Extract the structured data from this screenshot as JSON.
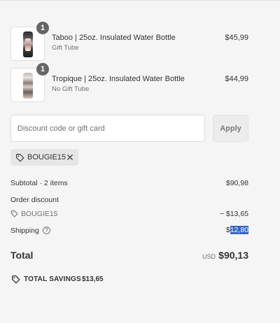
{
  "cart": {
    "items": [
      {
        "name": "Taboo | 25oz. Insulated Water Bottle",
        "variant": "Gift Tube",
        "price": "$45,99",
        "quantity": "1",
        "thumb": "taboo"
      },
      {
        "name": "Tropique | 25oz. Insulated Water Bottle",
        "variant": "No Gift Tube",
        "price": "$44,99",
        "quantity": "1",
        "thumb": "tropique"
      }
    ]
  },
  "discount": {
    "placeholder": "Discount code or gift card",
    "value": "",
    "apply_label": "Apply",
    "applied_code": "BOUGIE15"
  },
  "summary": {
    "subtotal_label": "Subtotal · 2 items",
    "subtotal_value": "$90,98",
    "order_discount_label": "Order discount",
    "code_label": "BOUGIE15",
    "code_value": "− $13,65",
    "shipping_label": "Shipping",
    "shipping_help": "?",
    "shipping_currency_symbol": "$",
    "shipping_value_selected": "12,80",
    "total_label": "Total",
    "total_currency": "USD",
    "total_value": "$90,13",
    "savings_label": "TOTAL SAVINGS",
    "savings_value": "$13,65"
  },
  "colors": {
    "background": "#f5f5f5",
    "selection": "#3465c7",
    "badge": "#666666"
  }
}
